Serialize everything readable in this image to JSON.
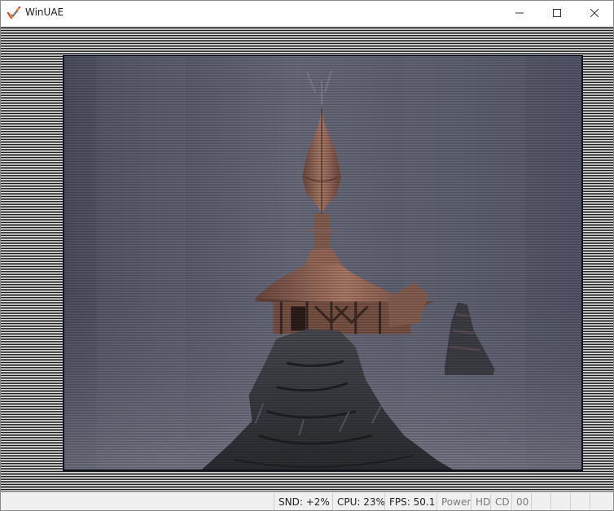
{
  "window": {
    "title": "WinUAE",
    "icon": "winuae-checkmark-icon",
    "controls": [
      "minimize-icon",
      "maximize-icon",
      "close-icon"
    ]
  },
  "statusbar": {
    "snd": "SND: +2%",
    "cpu": "CPU: 23%",
    "fps": "FPS: 50.1",
    "power": "Power",
    "hd": "HD",
    "cd": "CD",
    "floppy": "00"
  },
  "colors": {
    "scene_sky": "#5c5f70",
    "tower_copper": "#9a6a5a",
    "rock": "#3c3e46"
  }
}
